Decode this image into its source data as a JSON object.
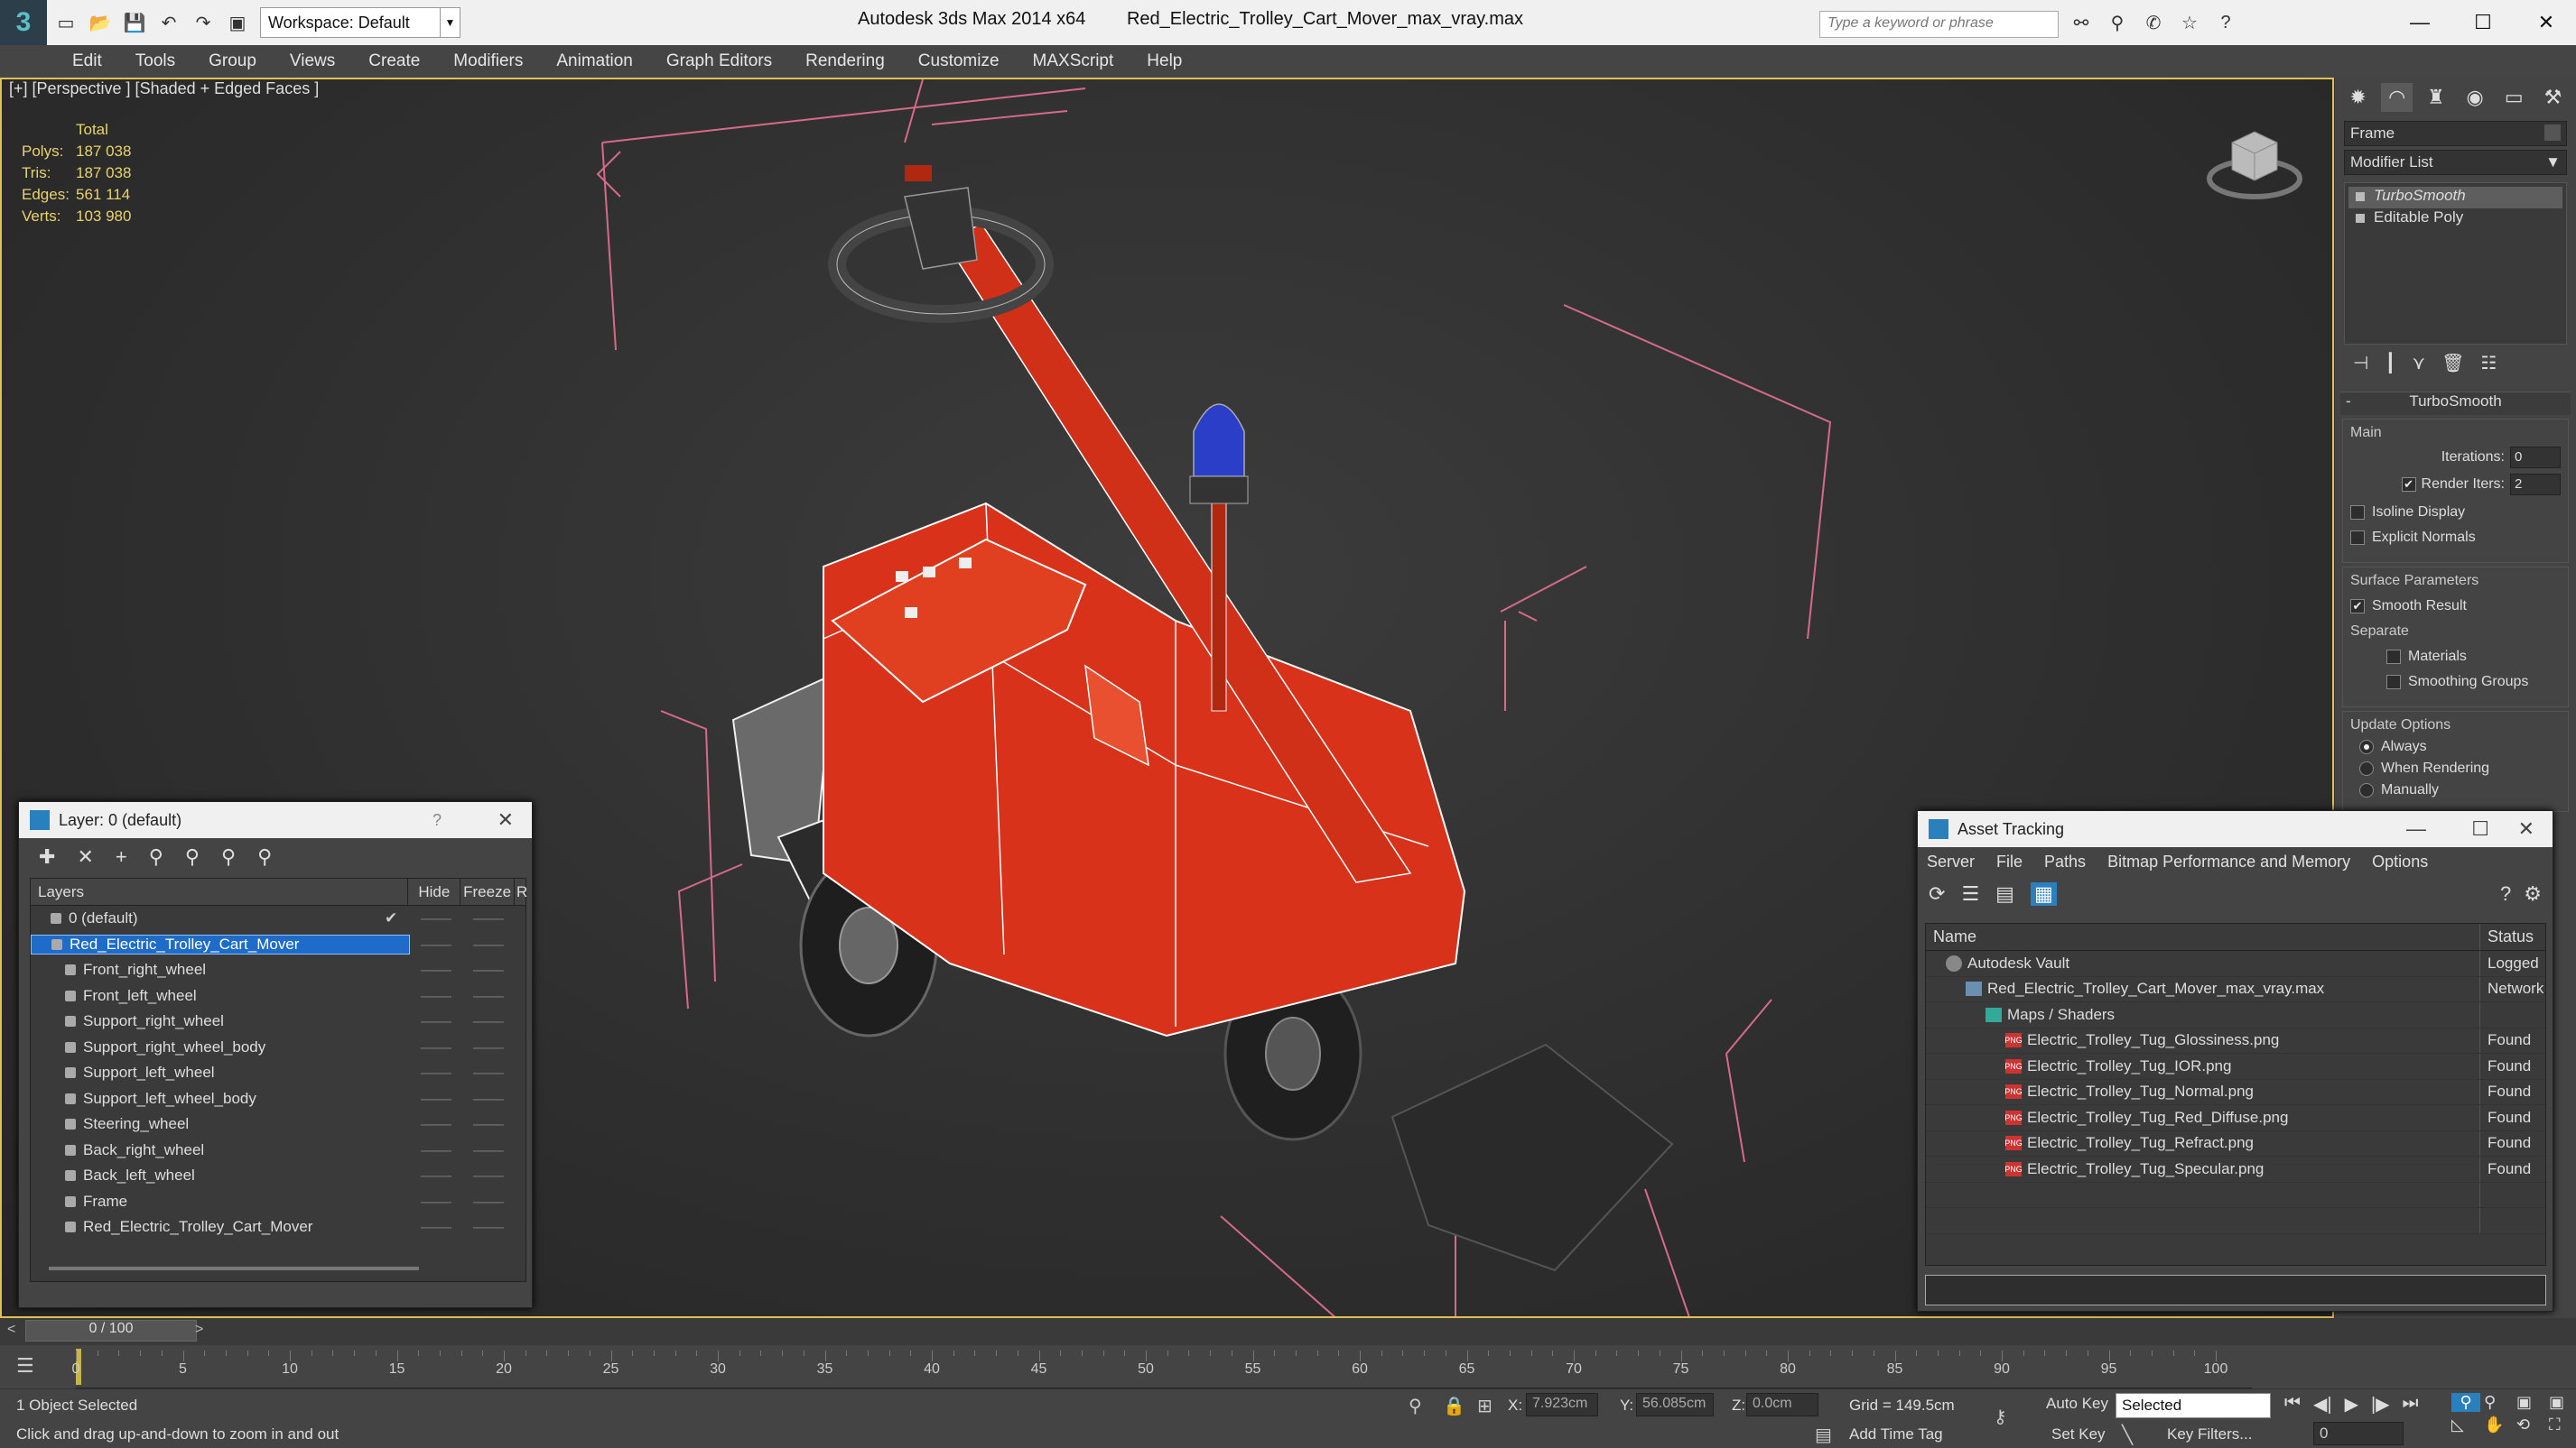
{
  "titlebar": {
    "workspace": "Workspace: Default",
    "app": "Autodesk 3ds Max  2014 x64",
    "file": "Red_Electric_Trolley_Cart_Mover_max_vray.max",
    "search_placeholder": "Type a keyword or phrase"
  },
  "menu": [
    "Edit",
    "Tools",
    "Group",
    "Views",
    "Create",
    "Modifiers",
    "Animation",
    "Graph Editors",
    "Rendering",
    "Customize",
    "MAXScript",
    "Help"
  ],
  "viewport": {
    "label": "[+] [Perspective ] [Shaded + Edged Faces ]",
    "stats_header": "Total",
    "stats": [
      {
        "k": "Polys:",
        "v": "187 038"
      },
      {
        "k": "Tris:",
        "v": "187 038"
      },
      {
        "k": "Edges:",
        "v": "561 114"
      },
      {
        "k": "Verts:",
        "v": "103 980"
      }
    ]
  },
  "cmdpanel": {
    "object_name": "Frame",
    "modifier_list": "Modifier List",
    "stack": [
      "TurboSmooth",
      "Editable Poly"
    ],
    "rollout_title": "TurboSmooth",
    "main_label": "Main",
    "iterations_label": "Iterations:",
    "iterations_value": "0",
    "render_iters_label": "Render Iters:",
    "render_iters_value": "2",
    "isoline": "Isoline Display",
    "explicit": "Explicit Normals",
    "surface_label": "Surface Parameters",
    "smooth_result": "Smooth Result",
    "separate_label": "Separate",
    "materials": "Materials",
    "smoothing_groups": "Smoothing Groups",
    "update_label": "Update Options",
    "always": "Always",
    "when_rendering": "When Rendering",
    "manually": "Manually"
  },
  "layer_dialog": {
    "title": "Layer: 0 (default)",
    "help": "?",
    "col_layers": "Layers",
    "col_hide": "Hide",
    "col_freeze": "Freeze",
    "col_r": "R",
    "dash": "——",
    "rows": [
      {
        "name": "0 (default)",
        "indent": 0
      },
      {
        "name": "Red_Electric_Trolley_Cart_Mover",
        "indent": 0
      },
      {
        "name": "Front_right_wheel",
        "indent": 1
      },
      {
        "name": "Front_left_wheel",
        "indent": 1
      },
      {
        "name": "Support_right_wheel",
        "indent": 1
      },
      {
        "name": "Support_right_wheel_body",
        "indent": 1
      },
      {
        "name": "Support_left_wheel",
        "indent": 1
      },
      {
        "name": "Support_left_wheel_body",
        "indent": 1
      },
      {
        "name": "Steering_wheel",
        "indent": 1
      },
      {
        "name": "Back_right_wheel",
        "indent": 1
      },
      {
        "name": "Back_left_wheel",
        "indent": 1
      },
      {
        "name": "Frame",
        "indent": 1
      },
      {
        "name": "Red_Electric_Trolley_Cart_Mover",
        "indent": 1
      }
    ]
  },
  "asset_dialog": {
    "title": "Asset Tracking",
    "menu": [
      "Server",
      "File",
      "Paths",
      "Bitmap Performance and Memory",
      "Options"
    ],
    "col_name": "Name",
    "col_status": "Status",
    "rows": [
      {
        "name": "Autodesk Vault",
        "status": "Logged O",
        "indent": 1,
        "icon": "vault"
      },
      {
        "name": "Red_Electric_Trolley_Cart_Mover_max_vray.max",
        "status": "Network",
        "indent": 2,
        "icon": "max"
      },
      {
        "name": "Maps / Shaders",
        "status": "",
        "indent": 3,
        "icon": "maps"
      },
      {
        "name": "Electric_Trolley_Tug_Glossiness.png",
        "status": "Found",
        "indent": 4,
        "icon": "png"
      },
      {
        "name": "Electric_Trolley_Tug_IOR.png",
        "status": "Found",
        "indent": 4,
        "icon": "png"
      },
      {
        "name": "Electric_Trolley_Tug_Normal.png",
        "status": "Found",
        "indent": 4,
        "icon": "png"
      },
      {
        "name": "Electric_Trolley_Tug_Red_Diffuse.png",
        "status": "Found",
        "indent": 4,
        "icon": "png"
      },
      {
        "name": "Electric_Trolley_Tug_Refract.png",
        "status": "Found",
        "indent": 4,
        "icon": "png"
      },
      {
        "name": "Electric_Trolley_Tug_Specular.png",
        "status": "Found",
        "indent": 4,
        "icon": "png"
      }
    ]
  },
  "timeline": {
    "position": "0 / 100",
    "ticks": [
      "0",
      "5",
      "10",
      "15",
      "20",
      "25",
      "30",
      "35",
      "40",
      "45",
      "50",
      "55",
      "60",
      "65",
      "70",
      "75",
      "80",
      "85",
      "90",
      "95",
      "100"
    ]
  },
  "statusbar": {
    "selected": "1 Object Selected",
    "hint": "Click and drag up-and-down to zoom in and out",
    "x_label": "X:",
    "x_value": "7.923cm",
    "y_label": "Y:",
    "y_value": "56.085cm",
    "z_label": "Z:",
    "z_value": "0.0cm",
    "grid": "Grid = 149.5cm",
    "add_time_tag": "Add Time Tag",
    "auto_key": "Auto Key",
    "set_key": "Set Key",
    "selected_dd": "Selected",
    "key_filters": "Key Filters...",
    "frame": "0"
  },
  "colors": {
    "model_red": "#d8331a",
    "viewport_border": "#e0c050",
    "selection_blue": "#1e6bc9"
  }
}
